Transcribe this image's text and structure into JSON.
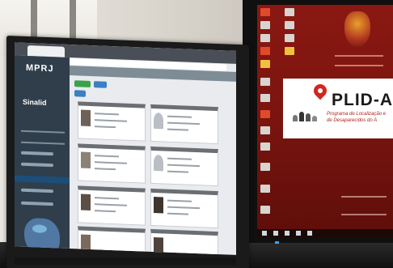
{
  "scene": {
    "description_labels": {
      "left_monitor": "left monitor",
      "right_monitor": "right monitor"
    }
  },
  "left_screen": {
    "brand": "MPRJ",
    "logo_text": "Sinalid",
    "header_text": "",
    "button_labels": [
      "",
      ""
    ]
  },
  "right_screen": {
    "plid_title": "PLID-A",
    "plid_line1": "Programa de Localização e",
    "plid_line2": "de Desaparecidos do A"
  },
  "colors": {
    "sidebar": "#2f3e4a",
    "desktop_red": "#7a140f",
    "pin_red": "#d3261d",
    "button_green": "#3aa34a",
    "button_blue": "#3b7fc4"
  }
}
